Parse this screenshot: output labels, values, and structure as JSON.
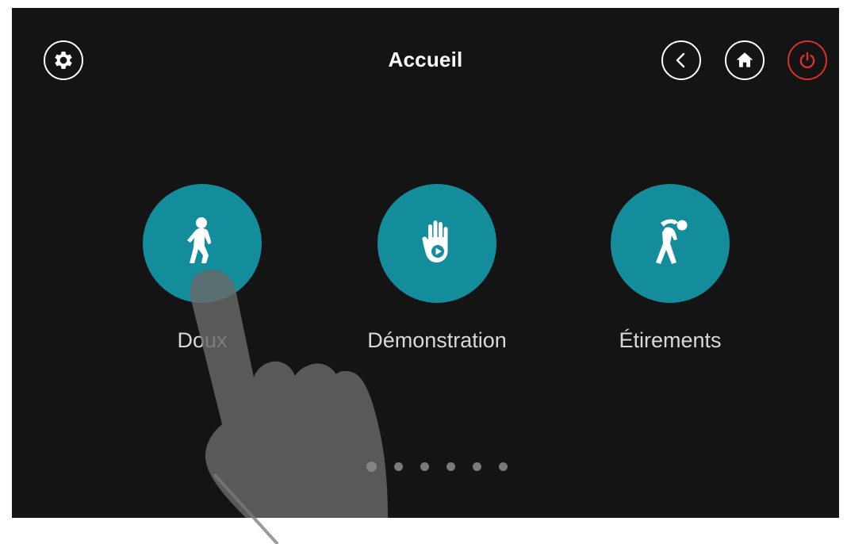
{
  "header": {
    "title": "Accueil",
    "settings_icon": "gear-icon",
    "back_icon": "chevron-left-icon",
    "home_icon": "home-icon",
    "power_icon": "power-icon"
  },
  "modes": [
    {
      "label": "Doux",
      "icon": "walking-person-icon"
    },
    {
      "label": "Démonstration",
      "icon": "hand-play-icon"
    },
    {
      "label": "Étirements",
      "icon": "stretching-person-icon"
    }
  ],
  "pager": {
    "total": 6,
    "active": 1
  },
  "colors": {
    "background": "#141414",
    "accent": "#138c9c",
    "power": "#d8312c",
    "text": "#ffffff"
  }
}
